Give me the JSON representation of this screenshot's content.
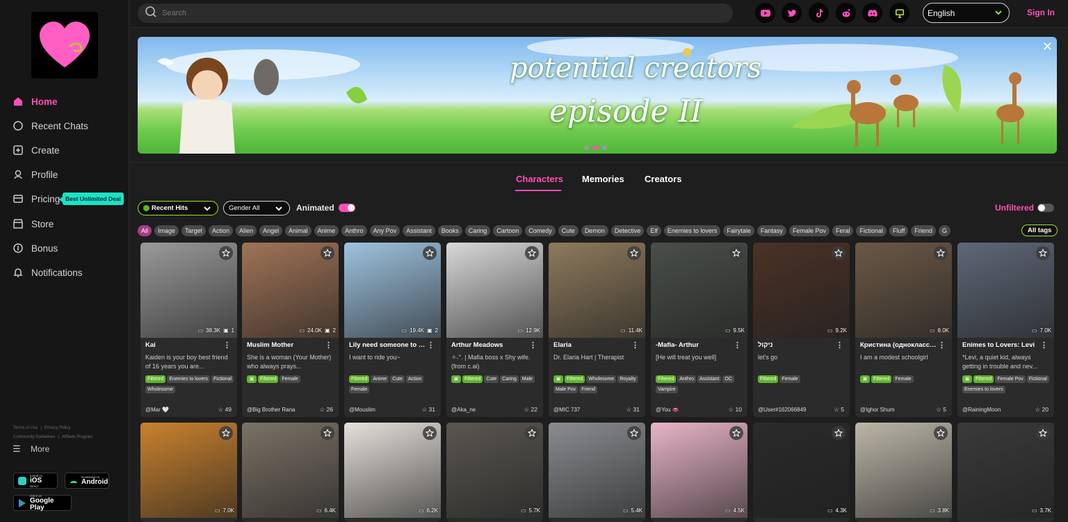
{
  "sidebar": {
    "nav": [
      {
        "label": "Home",
        "icon": "home-icon"
      },
      {
        "label": "Recent Chats",
        "icon": "chat-bubble-icon"
      },
      {
        "label": "Create",
        "icon": "plus-square-icon"
      },
      {
        "label": "Profile",
        "icon": "user-icon"
      },
      {
        "label": "Pricing",
        "icon": "card-icon"
      },
      {
        "label": "Store",
        "icon": "store-icon"
      },
      {
        "label": "Bonus",
        "icon": "coin-icon"
      },
      {
        "label": "Notifications",
        "icon": "bell-icon"
      }
    ],
    "deal_badge": "Best Unlimited Deal",
    "footer": {
      "terms": "Terms of Use",
      "privacy": "Privacy Policy",
      "guidelines": "Community Guidelines",
      "affiliate": "Affiliate Program",
      "sep": "|"
    },
    "more_label": "More",
    "ios": {
      "top": "Install on",
      "main": "iOS",
      "sub": "Direct"
    },
    "android": {
      "top": "Download on",
      "main": "Android"
    },
    "gplay": {
      "top": "Get it on",
      "main": "Google Play"
    }
  },
  "topbar": {
    "search_placeholder": "Search",
    "language": "English",
    "signin": "Sign In",
    "social": [
      "youtube-icon",
      "twitter-icon",
      "tiktok-icon",
      "reddit-icon",
      "discord-icon",
      "desktop-icon"
    ]
  },
  "banner": {
    "line1": "potential creators",
    "line2": "episode II",
    "close": "✕",
    "slide_count": 3,
    "active_slide": 2
  },
  "tabs": [
    "Characters",
    "Memories",
    "Creators"
  ],
  "filters": {
    "sort": "Recent Hits",
    "gender": "Gender All",
    "animated_label": "Animated",
    "animated_on": true,
    "unfiltered_label": "Unfiltered",
    "unfiltered_on": false
  },
  "tags": [
    "All",
    "Image",
    "Target",
    "Action",
    "Alien",
    "Angel",
    "Animal",
    "Anime",
    "Anthro",
    "Any Pov",
    "Assistant",
    "Books",
    "Caring",
    "Cartoon",
    "Comedy",
    "Cute",
    "Demon",
    "Detective",
    "Elf",
    "Enemies to lovers",
    "Fairytale",
    "Fantasy",
    "Female Pov",
    "Feral",
    "Fictional",
    "Fluff",
    "Friend",
    "G"
  ],
  "all_tags_label": "All tags",
  "cards": [
    {
      "name": "Kai",
      "desc": "Kaiden is your boy best friend of 16 years you are...",
      "chats": "38.3K",
      "imgs": "1",
      "tags": [
        "Filtered",
        "Enemies to lovers",
        "Fictional",
        "Wholesome"
      ],
      "img_tag": false,
      "author": "@Mar 🤍",
      "likes": "49",
      "bg": "#9a9a9a"
    },
    {
      "name": "Muslim Mother",
      "desc": "She is a woman (Your Mother) who always prays...",
      "chats": "24.0K",
      "imgs": "2",
      "tags": [
        "Filtered",
        "Female"
      ],
      "img_tag": true,
      "author": "@Big Brother Rana",
      "likes": "26",
      "bg": "#a07456"
    },
    {
      "name": "Lily need someone to f...",
      "desc": "I want to ride you~",
      "chats": "19.4K",
      "imgs": "2",
      "tags": [
        "Filtered",
        "Anime",
        "Cute",
        "Action",
        "Female"
      ],
      "img_tag": false,
      "author": "@Mouslim",
      "likes": "31",
      "bg": "#9ec4e0"
    },
    {
      "name": "Arthur Meadows",
      "desc": "✧˖°. | Mafia boss x Shy wife. (from c.ai)",
      "chats": "12.9K",
      "imgs": "",
      "tags": [
        "Filtered",
        "Cute",
        "Caring",
        "Male"
      ],
      "img_tag": true,
      "author": "@Aka_ne",
      "likes": "22",
      "bg": "#d8d8d8"
    },
    {
      "name": "Elaria",
      "desc": "Dr. Elaria Hart | Therapist",
      "chats": "11.4K",
      "imgs": "",
      "tags": [
        "Filtered",
        "Wholesome",
        "Royalty",
        "Male Pov",
        "Friend"
      ],
      "img_tag": true,
      "author": "@MIC 737",
      "likes": "31",
      "bg": "#8e7a5c"
    },
    {
      "name": "-Mafia- Arthur",
      "desc": "[He will treat you well]",
      "chats": "9.5K",
      "imgs": "",
      "tags": [
        "Filtered",
        "Anthro",
        "Assistant",
        "OC",
        "Vampire"
      ],
      "img_tag": false,
      "author": "@You 👄",
      "likes": "10",
      "bg": "#4a4f4a"
    },
    {
      "name": "ניקול",
      "desc": "let's go",
      "chats": "9.2K",
      "imgs": "",
      "tags": [
        "Filtered",
        "Female"
      ],
      "img_tag": false,
      "author": "@User#162066849",
      "likes": "5",
      "bg": "#4a3226"
    },
    {
      "name": "Кристина (одноклассн...",
      "desc": "I am a modest schoolgirl",
      "chats": "8.0K",
      "imgs": "",
      "tags": [
        "Filtered",
        "Female"
      ],
      "img_tag": true,
      "author": "@Ighor Shum",
      "likes": "5",
      "bg": "#6b5846"
    },
    {
      "name": "Enimes to Lovers: Levi",
      "desc": "*Levi, a quiet kid, always getting in trouble and nev...",
      "chats": "7.0K",
      "imgs": "",
      "tags": [
        "Filtered",
        "Female Pov",
        "Fictional",
        "Enemies to lovers"
      ],
      "img_tag": true,
      "author": "@RainingMoon",
      "likes": "20",
      "bg": "#5e6878"
    },
    {
      "name": "",
      "desc": "",
      "chats": "7.0K",
      "imgs": "",
      "tags": [],
      "img_tag": false,
      "author": "",
      "likes": "",
      "bg": "#c9822e"
    },
    {
      "name": "",
      "desc": "",
      "chats": "6.4K",
      "imgs": "",
      "tags": [],
      "img_tag": false,
      "author": "",
      "likes": "",
      "bg": "#7a7266"
    },
    {
      "name": "",
      "desc": "",
      "chats": "6.2K",
      "imgs": "",
      "tags": [],
      "img_tag": false,
      "author": "",
      "likes": "",
      "bg": "#e6e0da"
    },
    {
      "name": "",
      "desc": "",
      "chats": "5.7K",
      "imgs": "",
      "tags": [],
      "img_tag": false,
      "author": "",
      "likes": "",
      "bg": "#5a5650"
    },
    {
      "name": "",
      "desc": "",
      "chats": "5.4K",
      "imgs": "",
      "tags": [],
      "img_tag": false,
      "author": "",
      "likes": "",
      "bg": "#8a8c90"
    },
    {
      "name": "",
      "desc": "",
      "chats": "4.5K",
      "imgs": "",
      "tags": [],
      "img_tag": false,
      "author": "",
      "likes": "",
      "bg": "#e8b4c8"
    },
    {
      "name": "",
      "desc": "",
      "chats": "4.3K",
      "imgs": "",
      "tags": [],
      "img_tag": false,
      "author": "",
      "likes": "",
      "bg": "#2a2a2a"
    },
    {
      "name": "",
      "desc": "",
      "chats": "3.8K",
      "imgs": "",
      "tags": [],
      "img_tag": false,
      "author": "",
      "likes": "",
      "bg": "#bcb6a8"
    },
    {
      "name": "",
      "desc": "",
      "chats": "3.7K",
      "imgs": "",
      "tags": [],
      "img_tag": false,
      "author": "",
      "likes": "",
      "bg": "#3a3a3a"
    }
  ],
  "colors": {
    "accent": "#ff4fb8",
    "tag_green": "#5fb52a",
    "deal": "#19e3c6"
  }
}
